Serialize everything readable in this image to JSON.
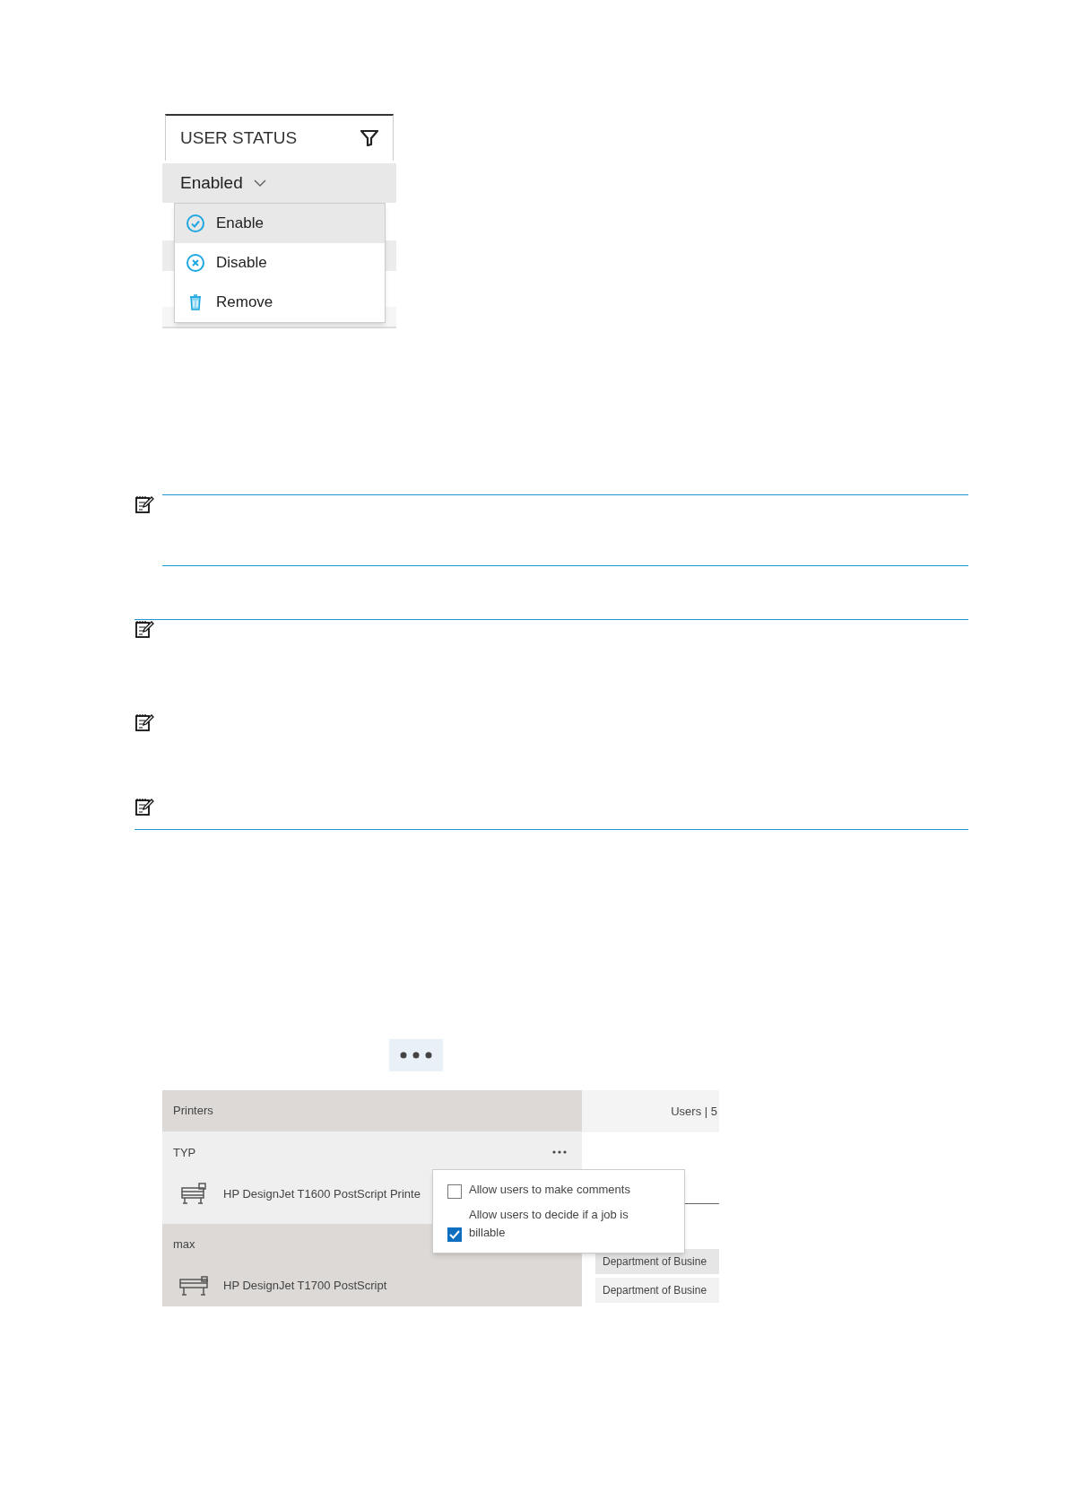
{
  "status_filter": {
    "header": "USER STATUS",
    "value": "Enabled",
    "menu": [
      {
        "label": "Enable",
        "kind": "enable",
        "highlighted": true
      },
      {
        "label": "Disable",
        "kind": "disable",
        "highlighted": false
      },
      {
        "label": "Remove",
        "kind": "remove",
        "highlighted": false
      }
    ]
  },
  "printers_panel": {
    "header": "Printers",
    "groups": [
      {
        "name": "TYP",
        "selected": true,
        "printers": [
          {
            "name": "HP DesignJet T1600 PostScript Printe"
          }
        ]
      },
      {
        "name": "max",
        "selected": false,
        "printers": [
          {
            "name": "HP DesignJet T1700 PostScript"
          }
        ]
      }
    ]
  },
  "users_panel": {
    "header": "Users | 5",
    "rows": [
      "Department of Busine",
      "Department of Busine"
    ]
  },
  "options_popover": {
    "options": [
      {
        "label": "Allow users to make comments",
        "checked": false
      },
      {
        "label": "Allow users to decide if a job is billable",
        "checked": true
      }
    ]
  }
}
